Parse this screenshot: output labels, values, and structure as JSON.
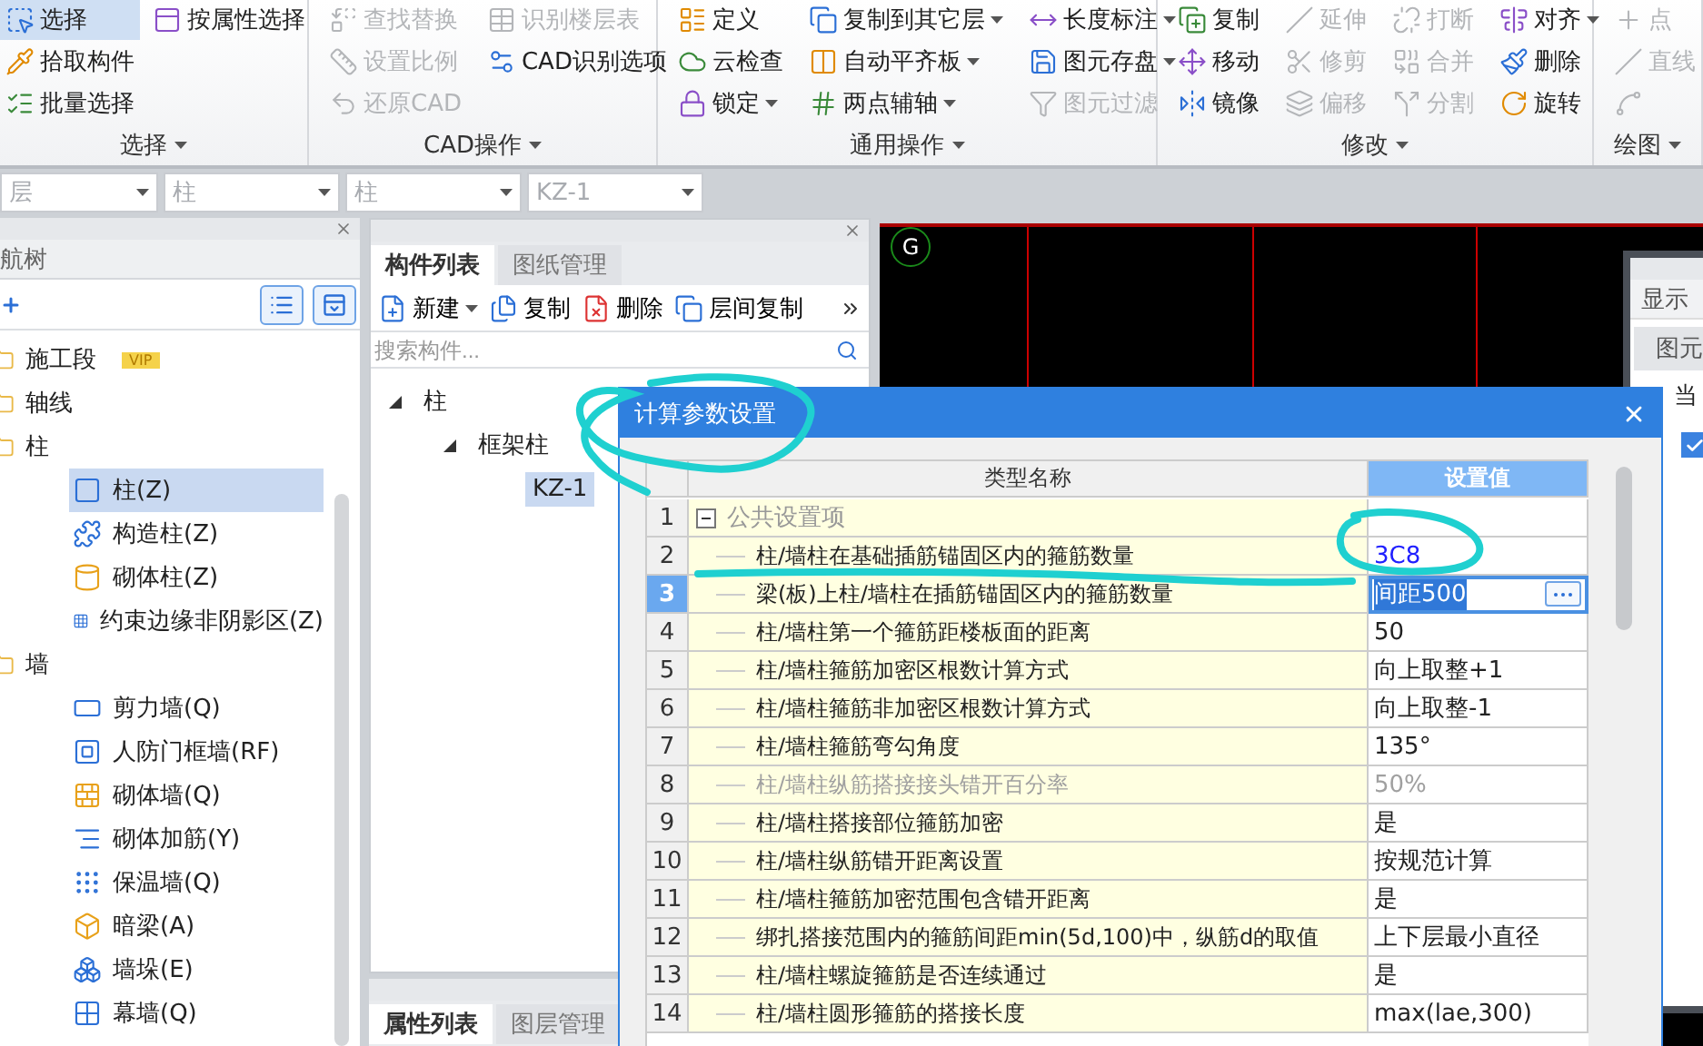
{
  "ribbon": {
    "groups": [
      {
        "label": "选择",
        "columns": [
          [
            {
              "label": "选择",
              "selected": true,
              "disabled": false,
              "dropdown": false
            },
            {
              "label": "拾取构件",
              "selected": false,
              "disabled": false,
              "dropdown": false
            },
            {
              "label": "批量选择",
              "selected": false,
              "disabled": false,
              "dropdown": false
            }
          ],
          [
            {
              "label": "按属性选择",
              "selected": false,
              "disabled": false,
              "dropdown": false
            }
          ]
        ]
      },
      {
        "label": "CAD操作",
        "columns": [
          [
            {
              "label": "查找替换",
              "selected": false,
              "disabled": true,
              "dropdown": false
            },
            {
              "label": "设置比例",
              "selected": false,
              "disabled": true,
              "dropdown": false
            },
            {
              "label": "还原CAD",
              "selected": false,
              "disabled": true,
              "dropdown": false
            }
          ],
          [
            {
              "label": "识别楼层表",
              "selected": false,
              "disabled": true,
              "dropdown": false
            },
            {
              "label": "CAD识别选项",
              "selected": false,
              "disabled": false,
              "dropdown": false
            }
          ]
        ]
      },
      {
        "label": "通用操作",
        "columns": [
          [
            {
              "label": "定义",
              "selected": false,
              "disabled": false,
              "dropdown": false
            },
            {
              "label": "云检查",
              "selected": false,
              "disabled": false,
              "dropdown": false
            },
            {
              "label": "锁定",
              "selected": false,
              "disabled": false,
              "dropdown": true
            }
          ],
          [
            {
              "label": "复制到其它层",
              "selected": false,
              "disabled": false,
              "dropdown": true
            },
            {
              "label": "自动平齐板",
              "selected": false,
              "disabled": false,
              "dropdown": true
            },
            {
              "label": "两点辅轴",
              "selected": false,
              "disabled": false,
              "dropdown": true
            }
          ],
          [
            {
              "label": "长度标注",
              "selected": false,
              "disabled": false,
              "dropdown": true
            },
            {
              "label": "图元存盘",
              "selected": false,
              "disabled": false,
              "dropdown": true
            },
            {
              "label": "图元过滤",
              "selected": false,
              "disabled": true,
              "dropdown": false
            }
          ]
        ]
      },
      {
        "label": "修改",
        "columns": [
          [
            {
              "label": "复制",
              "selected": false,
              "disabled": false,
              "dropdown": false
            },
            {
              "label": "移动",
              "selected": false,
              "disabled": false,
              "dropdown": false
            },
            {
              "label": "镜像",
              "selected": false,
              "disabled": false,
              "dropdown": false
            }
          ],
          [
            {
              "label": "延伸",
              "selected": false,
              "disabled": true,
              "dropdown": false
            },
            {
              "label": "修剪",
              "selected": false,
              "disabled": true,
              "dropdown": false
            },
            {
              "label": "偏移",
              "selected": false,
              "disabled": true,
              "dropdown": false
            }
          ],
          [
            {
              "label": "打断",
              "selected": false,
              "disabled": true,
              "dropdown": false
            },
            {
              "label": "合并",
              "selected": false,
              "disabled": true,
              "dropdown": false
            },
            {
              "label": "分割",
              "selected": false,
              "disabled": true,
              "dropdown": false
            }
          ],
          [
            {
              "label": "对齐",
              "selected": false,
              "disabled": false,
              "dropdown": true
            },
            {
              "label": "删除",
              "selected": false,
              "disabled": false,
              "dropdown": false
            },
            {
              "label": "旋转",
              "selected": false,
              "disabled": false,
              "dropdown": false
            }
          ]
        ]
      },
      {
        "label": "绘图",
        "columns": [
          [
            {
              "label": "点",
              "selected": false,
              "disabled": true,
              "dropdown": false
            },
            {
              "label": "直线",
              "selected": false,
              "disabled": true,
              "dropdown": false
            },
            {
              "selected": false,
              "disabled": true,
              "dropdown": false
            }
          ]
        ]
      }
    ]
  },
  "selector_bar": [
    "层",
    "柱",
    "柱",
    "KZ-1"
  ],
  "left_panel": {
    "title": "航树",
    "tree": [
      {
        "label": "施工段",
        "badge": "VIP"
      },
      {
        "label": "轴线"
      },
      {
        "label": "柱",
        "children": [
          {
            "label": "柱(Z)",
            "selected": true
          },
          {
            "label": "构造柱(Z)",
            "selected": false
          },
          {
            "label": "砌体柱(Z)",
            "selected": false
          },
          {
            "label": "约束边缘非阴影区(Z)",
            "selected": false
          }
        ]
      },
      {
        "label": "墙",
        "children": [
          {
            "label": "剪力墙(Q)",
            "selected": false
          },
          {
            "label": "人防门框墙(RF)",
            "selected": false
          },
          {
            "label": "砌体墙(Q)",
            "selected": false
          },
          {
            "label": "砌体加筋(Y)",
            "selected": false
          },
          {
            "label": "保温墙(Q)",
            "selected": false
          },
          {
            "label": "暗梁(A)",
            "selected": false
          },
          {
            "label": "墙垛(E)",
            "selected": false
          },
          {
            "label": "幕墙(Q)",
            "selected": false
          }
        ]
      }
    ]
  },
  "middle_panel": {
    "tabs": [
      {
        "label": "构件列表",
        "selected": true
      },
      {
        "label": "图纸管理",
        "selected": false
      }
    ],
    "toolbar": [
      {
        "label": "新建",
        "dropdown": true
      },
      {
        "label": "复制",
        "dropdown": false
      },
      {
        "label": "删除",
        "dropdown": false
      },
      {
        "label": "层间复制",
        "dropdown": false
      }
    ],
    "search": {
      "placeholder": "搜索构件..."
    },
    "tree": [
      {
        "label": "柱",
        "selected": false,
        "children": [
          {
            "label": "框架柱",
            "selected": false,
            "children": [
              {
                "label": "KZ-1",
                "selected": true
              }
            ]
          }
        ]
      }
    ],
    "bottom_tabs": [
      {
        "label": "属性列表",
        "selected": true
      },
      {
        "label": "图层管理",
        "selected": false
      }
    ]
  },
  "canvas": {
    "marker": "G",
    "display_panel": {
      "title": "显示",
      "tab": "图元",
      "radio_label": "当",
      "checkbox_checked": true
    }
  },
  "dialog": {
    "title": "计算参数设置",
    "columns": [
      "类型名称",
      "设置值"
    ],
    "rows": [
      {
        "number": "1",
        "kind": "group",
        "label": "公共设置项",
        "expanded": true
      },
      {
        "number": "2",
        "kind": "item",
        "name": "柱/墙柱在基础插筋锚固区内的箍筋数量",
        "value": "3C8",
        "modified": true,
        "disabled": false,
        "selected": false
      },
      {
        "number": "3",
        "kind": "item",
        "name": "梁(板)上柱/墙柱在插筋锚固区内的箍筋数量",
        "value": "间距500",
        "modified": false,
        "disabled": false,
        "selected": true
      },
      {
        "number": "4",
        "kind": "item",
        "name": "柱/墙柱第一个箍筋距楼板面的距离",
        "value": "50",
        "modified": false,
        "disabled": false,
        "selected": false
      },
      {
        "number": "5",
        "kind": "item",
        "name": "柱/墙柱箍筋加密区根数计算方式",
        "value": "向上取整+1",
        "modified": false,
        "disabled": false,
        "selected": false
      },
      {
        "number": "6",
        "kind": "item",
        "name": "柱/墙柱箍筋非加密区根数计算方式",
        "value": "向上取整-1",
        "modified": false,
        "disabled": false,
        "selected": false
      },
      {
        "number": "7",
        "kind": "item",
        "name": "柱/墙柱箍筋弯勾角度",
        "value": "135°",
        "modified": false,
        "disabled": false,
        "selected": false
      },
      {
        "number": "8",
        "kind": "item",
        "name": "柱/墙柱纵筋搭接接头错开百分率",
        "value": "50%",
        "modified": false,
        "disabled": true,
        "selected": false
      },
      {
        "number": "9",
        "kind": "item",
        "name": "柱/墙柱搭接部位箍筋加密",
        "value": "是",
        "modified": false,
        "disabled": false,
        "selected": false
      },
      {
        "number": "10",
        "kind": "item",
        "name": "柱/墙柱纵筋错开距离设置",
        "value": "按规范计算",
        "modified": false,
        "disabled": false,
        "selected": false
      },
      {
        "number": "11",
        "kind": "item",
        "name": "柱/墙柱箍筋加密范围包含错开距离",
        "value": "是",
        "modified": false,
        "disabled": false,
        "selected": false
      },
      {
        "number": "12",
        "kind": "item",
        "name": "绑扎搭接范围内的箍筋间距min(5d,100)中，纵筋d的取值",
        "value": "上下层最小直径",
        "modified": false,
        "disabled": false,
        "selected": false
      },
      {
        "number": "13",
        "kind": "item",
        "name": "柱/墙柱螺旋箍筋是否连续通过",
        "value": "是",
        "modified": false,
        "disabled": false,
        "selected": false
      },
      {
        "number": "14",
        "kind": "item",
        "name": "柱/墙柱圆形箍筋的搭接长度",
        "value": "max(lae,300)",
        "modified": false,
        "disabled": false,
        "selected": false
      }
    ]
  }
}
